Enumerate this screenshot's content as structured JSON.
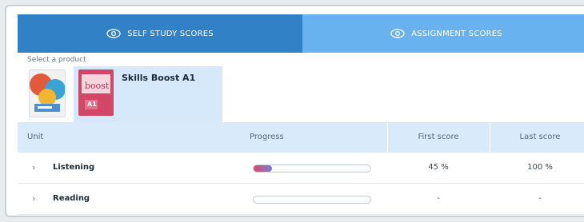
{
  "tabs": {
    "self_study": "SELF STUDY SCORES",
    "assignment": "ASSIGNMENT SCORES"
  },
  "product_picker": {
    "label": "Select a product",
    "selected_product": "Skills Boost A1",
    "cover_text": {
      "series": "boost",
      "level": "A1"
    }
  },
  "table": {
    "headers": {
      "unit": "Unit",
      "progress": "Progress",
      "first": "First score",
      "last": "Last score"
    },
    "rows": [
      {
        "unit": "Listening",
        "progress_percent": 16,
        "first": "45 %",
        "last": "100 %"
      },
      {
        "unit": "Reading",
        "progress_percent": 0,
        "first": "-",
        "last": "-"
      }
    ]
  },
  "colors": {
    "tab_active": "#3181c7",
    "tab_inactive": "#68b2f0",
    "header_bg": "#d9ebfb",
    "progress_start": "#e0476a",
    "progress_end": "#6f7fd6"
  }
}
